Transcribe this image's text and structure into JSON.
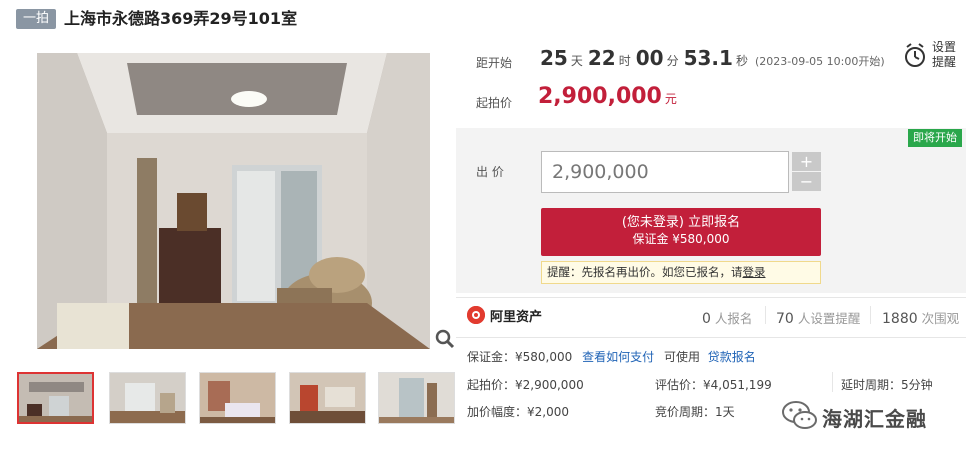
{
  "header": {
    "badge": "一拍",
    "title": "上海市永德路369弄29号101室"
  },
  "countdown": {
    "label": "距开始",
    "days": "25",
    "days_unit": "天",
    "hours": "22",
    "hours_unit": "时",
    "minutes": "00",
    "minutes_unit": "分",
    "seconds": "53.1",
    "seconds_unit": "秒",
    "start_time": "(2023-09-05 10:00开始)"
  },
  "starting": {
    "label": "起拍价",
    "price": "2,900,000",
    "unit": "元"
  },
  "reminder": {
    "line1": "设置",
    "line2": "提醒"
  },
  "bid": {
    "status_badge": "即将开始",
    "label": "出 价",
    "value": "2,900,000",
    "plus": "+",
    "minus": "−",
    "signup_line1": "(您未登录) 立即报名",
    "signup_line2": "保证金 ¥580,000",
    "tip_prefix": "提醒：先报名再出价。如您已报名，请",
    "tip_link": "登录"
  },
  "stats": {
    "brand": "阿里资产",
    "signups": "0",
    "signups_label": "人报名",
    "reminders": "70",
    "reminders_label": "人设置提醒",
    "views": "1880",
    "views_label": "次围观"
  },
  "deposit": {
    "text": "保证金：¥580,000",
    "how_to_pay": "查看如何支付",
    "usable": "可使用",
    "loan_signup": "贷款报名"
  },
  "details": {
    "start_price": "起拍价：¥2,900,000",
    "assessed_price": "评估价：¥4,051,199",
    "delay_period": "延时周期：5分钟",
    "increment": "加价幅度：¥2,000",
    "bid_period": "竞价周期：1天"
  },
  "watermark": {
    "text": "海湖汇金融",
    "icon": "wechat-icon"
  },
  "colors": {
    "accent_red": "#c21f3a",
    "badge_green": "#2aa74b",
    "link_blue": "#1f63b6",
    "badge_gray": "#8a96a3"
  }
}
